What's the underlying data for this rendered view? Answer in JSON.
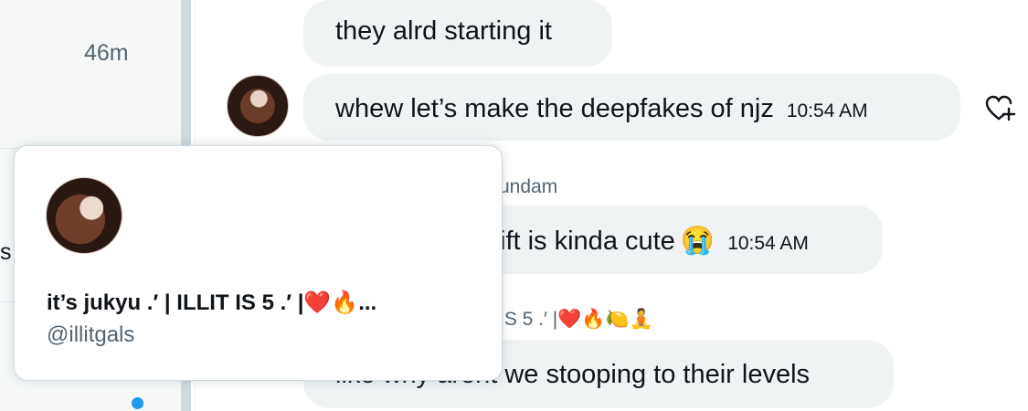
{
  "conversation_list": {
    "time_label": "46m",
    "partial_text": "s"
  },
  "messages": [
    {
      "text": "they alrd starting it"
    },
    {
      "text": "whew let’s make the deepfakes of njz",
      "time": "10:54 AM"
    },
    {
      "sender": "undam",
      "text": "ift is kinda cute",
      "emoji": "😭",
      "time": "10:54 AM"
    },
    {
      "sender": "IS 5 .′ |❤️🔥🍋🧘",
      "text": "like why arent we stooping to their levels"
    }
  ],
  "hover_card": {
    "display_name": "it’s jukyu .′ | ILLIT IS 5 .′ |❤️🔥...",
    "handle": "@illitgals"
  },
  "icons": {
    "react": "heart-plus-icon",
    "unread": "unread-dot"
  },
  "colors": {
    "bubble_bg": "#eff3f4",
    "secondary_text": "#536471",
    "accent_blue": "#1d9bf0"
  }
}
